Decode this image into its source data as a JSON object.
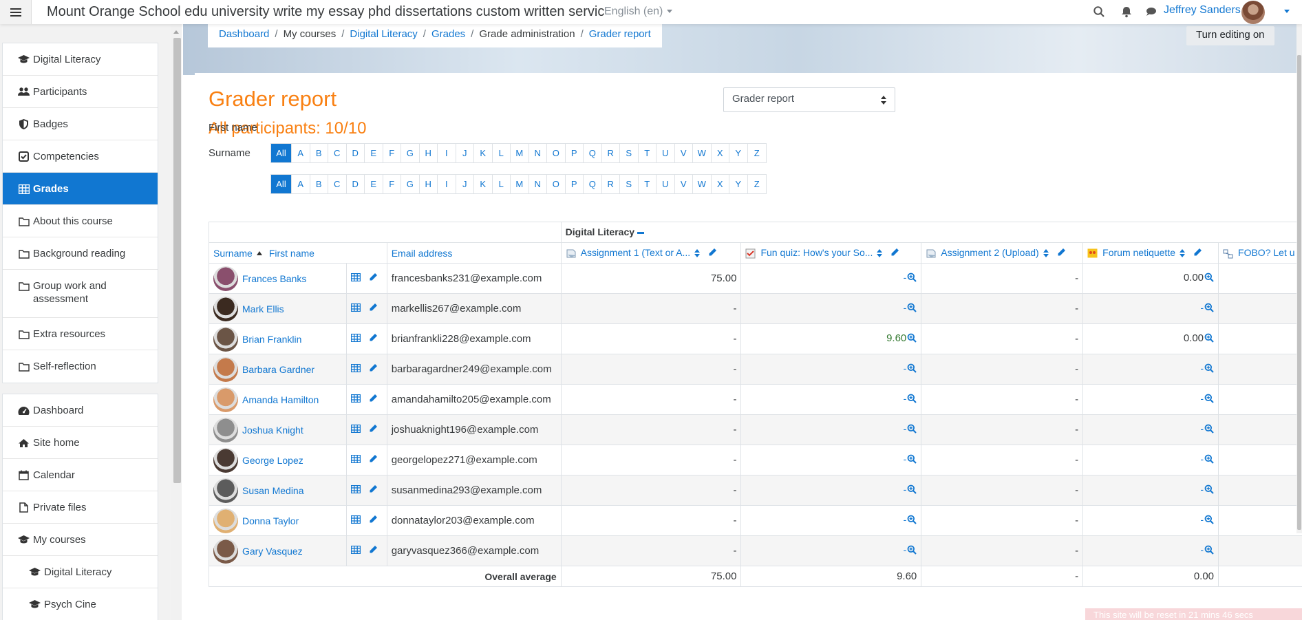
{
  "navbar": {
    "site_title": "Mount Orange School edu university write my essay phd dissertations custom written servic",
    "language": "English (en)",
    "user_name": "Jeffrey Sanders",
    "icons": [
      "search-icon",
      "bell-icon",
      "chat-icon"
    ]
  },
  "drawer": {
    "course_nav": [
      {
        "label": "Digital Literacy",
        "icon": "graduation-cap-icon"
      },
      {
        "label": "Participants",
        "icon": "users-icon"
      },
      {
        "label": "Badges",
        "icon": "shield-icon"
      },
      {
        "label": "Competencies",
        "icon": "check-square-icon"
      },
      {
        "label": "Grades",
        "icon": "table-icon"
      },
      {
        "label": "About this course",
        "icon": "folder-icon"
      },
      {
        "label": "Background reading",
        "icon": "folder-icon"
      },
      {
        "label": "Group work and assessment",
        "icon": "folder-icon"
      },
      {
        "label": "Extra resources",
        "icon": "folder-icon"
      },
      {
        "label": "Self-reflection",
        "icon": "folder-icon"
      }
    ],
    "site_nav": [
      {
        "label": "Dashboard",
        "icon": "tachometer-icon"
      },
      {
        "label": "Site home",
        "icon": "home-icon"
      },
      {
        "label": "Calendar",
        "icon": "calendar-icon"
      },
      {
        "label": "Private files",
        "icon": "file-icon"
      },
      {
        "label": "My courses",
        "icon": "graduation-cap-icon"
      },
      {
        "label": "Digital Literacy",
        "icon": "graduation-cap-icon"
      },
      {
        "label": "Psych Cine",
        "icon": "graduation-cap-icon"
      }
    ]
  },
  "breadcrumb": {
    "items": [
      "Dashboard",
      "My courses",
      "Digital Literacy",
      "Grades",
      "Grade administration",
      "Grader report"
    ]
  },
  "header": {
    "editing_button": "Turn editing on"
  },
  "report": {
    "title": "Grader report",
    "participants": "All participants: 10/10",
    "selector_value": "Grader report",
    "first_name_label": "First name",
    "surname_label": "Surname",
    "all_label": "All",
    "letters": [
      "A",
      "B",
      "C",
      "D",
      "E",
      "F",
      "G",
      "H",
      "I",
      "J",
      "K",
      "L",
      "M",
      "N",
      "O",
      "P",
      "Q",
      "R",
      "S",
      "T",
      "U",
      "V",
      "W",
      "X",
      "Y",
      "Z"
    ]
  },
  "table": {
    "category": "Digital Literacy",
    "col_surname": "Surname",
    "col_firstname": "First name",
    "col_email": "Email address",
    "items": [
      {
        "label": "Assignment 1 (Text or A...",
        "icon": "assignment-icon"
      },
      {
        "label": "Fun quiz: How's your So...",
        "icon": "quiz-icon"
      },
      {
        "label": "Assignment 2 (Upload)",
        "icon": "assignment-icon"
      },
      {
        "label": "Forum netiquette",
        "icon": "forum-icon"
      },
      {
        "label": "FOBO? Let u",
        "icon": "workshop-icon"
      }
    ],
    "rows": [
      {
        "name": "Frances Banks",
        "email": "francesbanks231@example.com",
        "a1": "75.00",
        "quiz": "-",
        "quiz_green": false,
        "a2": "-",
        "forum": "0.00",
        "avatar": "#8a4f6d"
      },
      {
        "name": "Mark Ellis",
        "email": "markellis267@example.com",
        "a1": "-",
        "quiz": "-",
        "quiz_green": false,
        "a2": "-",
        "forum": "-",
        "avatar": "#3b2a20"
      },
      {
        "name": "Brian Franklin",
        "email": "brianfrankli228@example.com",
        "a1": "-",
        "quiz": "9.60",
        "quiz_green": true,
        "a2": "-",
        "forum": "0.00",
        "avatar": "#6b5546"
      },
      {
        "name": "Barbara Gardner",
        "email": "barbaragardner249@example.com",
        "a1": "-",
        "quiz": "-",
        "quiz_green": false,
        "a2": "-",
        "forum": "-",
        "avatar": "#c47a4b"
      },
      {
        "name": "Amanda Hamilton",
        "email": "amandahamilto205@example.com",
        "a1": "-",
        "quiz": "-",
        "quiz_green": false,
        "a2": "-",
        "forum": "-",
        "avatar": "#d99a6a"
      },
      {
        "name": "Joshua Knight",
        "email": "joshuaknight196@example.com",
        "a1": "-",
        "quiz": "-",
        "quiz_green": false,
        "a2": "-",
        "forum": "-",
        "avatar": "#8e8e8e"
      },
      {
        "name": "George Lopez",
        "email": "georgelopez271@example.com",
        "a1": "-",
        "quiz": "-",
        "quiz_green": false,
        "a2": "-",
        "forum": "-",
        "avatar": "#4a3a33"
      },
      {
        "name": "Susan Medina",
        "email": "susanmedina293@example.com",
        "a1": "-",
        "quiz": "-",
        "quiz_green": false,
        "a2": "-",
        "forum": "-",
        "avatar": "#5c5c5c"
      },
      {
        "name": "Donna Taylor",
        "email": "donnataylor203@example.com",
        "a1": "-",
        "quiz": "-",
        "quiz_green": false,
        "a2": "-",
        "forum": "-",
        "avatar": "#e0b072"
      },
      {
        "name": "Gary Vasquez",
        "email": "garyvasquez366@example.com",
        "a1": "-",
        "quiz": "-",
        "quiz_green": false,
        "a2": "-",
        "forum": "-",
        "avatar": "#7a5a48"
      }
    ],
    "average_label": "Overall average",
    "averages": {
      "a1": "75.00",
      "quiz": "9.60",
      "a2": "-",
      "forum": "0.00"
    }
  },
  "toast": "This site will be reset in 21 mins 46 secs",
  "colors": {
    "brand": "#f98012",
    "link": "#1177d1",
    "active_nav": "#1177d1"
  }
}
